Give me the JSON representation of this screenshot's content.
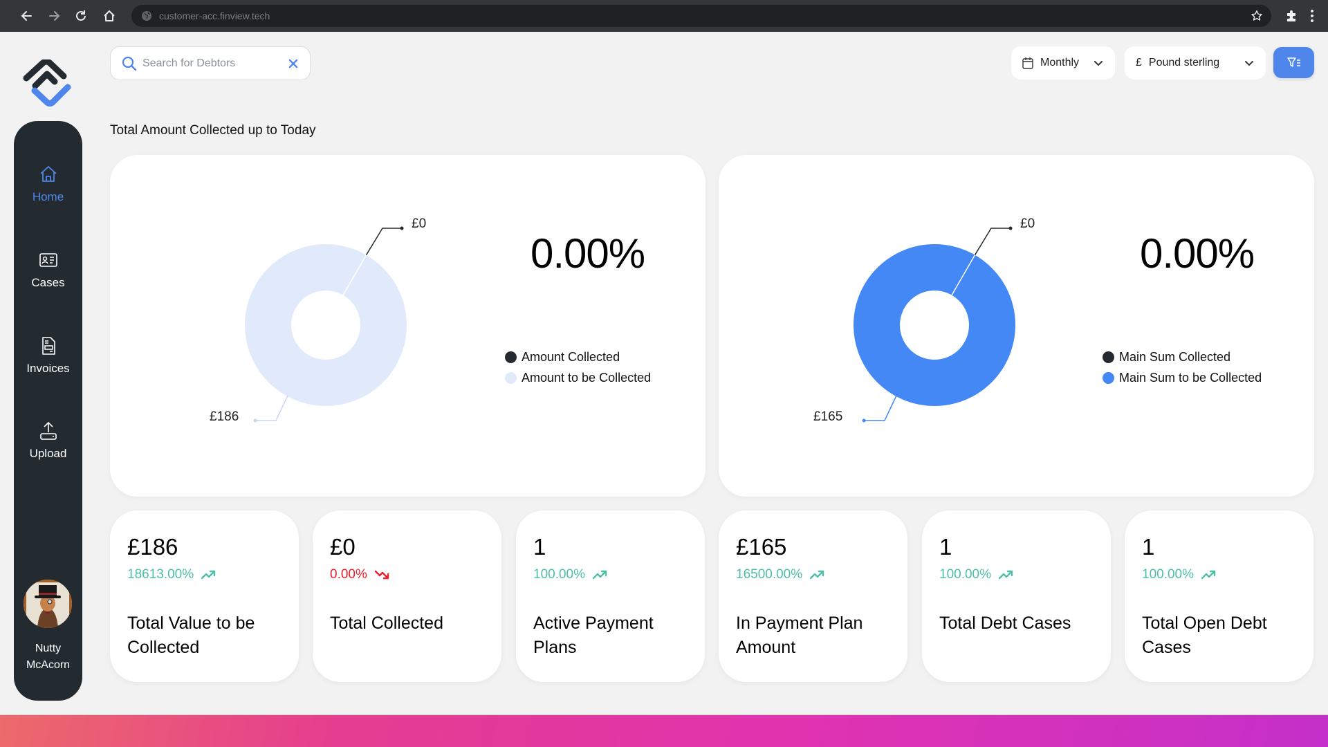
{
  "browser": {
    "url": "customer-acc.finview.tech",
    "icons": [
      "back-arrow-icon",
      "forward-arrow-icon",
      "reload-icon",
      "home-icon",
      "globe-icon",
      "bookmark-star-icon",
      "extensions-puzzle-icon",
      "kebab-menu-icon"
    ]
  },
  "search": {
    "placeholder": "Search for Debtors",
    "value": ""
  },
  "toolbar": {
    "period_label": "Monthly",
    "currency_symbol": "£",
    "currency_label": "Pound sterling"
  },
  "sidebar": {
    "items": [
      {
        "label": "Home",
        "icon": "home-icon",
        "active": true
      },
      {
        "label": "Cases",
        "icon": "id-card-icon",
        "active": false
      },
      {
        "label": "Invoices",
        "icon": "invoice-document-icon",
        "active": false
      },
      {
        "label": "Upload",
        "icon": "upload-icon",
        "active": false
      }
    ],
    "user": {
      "first_name": "Nutty",
      "last_name": "McAcorn"
    }
  },
  "section_title": "Total Amount Collected up to Today",
  "colors": {
    "accent": "#4f86ec",
    "dark": "#232b30",
    "positive": "#4ebfa7",
    "negative": "#f01d2a",
    "light_blue": "#e1eafb",
    "chart_blue": "#4488f6"
  },
  "chart_data": [
    {
      "type": "pie",
      "variant": "donut",
      "title": "Amount Collected",
      "percentage_label": "0.00%",
      "categories": [
        "Amount Collected",
        "Amount to be Collected"
      ],
      "values": [
        0,
        186
      ],
      "value_labels": [
        "£0",
        "£186"
      ],
      "colors": [
        "#232b30",
        "#e1eafb"
      ],
      "legend": "right"
    },
    {
      "type": "pie",
      "variant": "donut",
      "title": "Main Sum Collected",
      "percentage_label": "0.00%",
      "categories": [
        "Main Sum Collected",
        "Main Sum to be Collected"
      ],
      "values": [
        0,
        165
      ],
      "value_labels": [
        "£0",
        "£165"
      ],
      "colors": [
        "#232b30",
        "#4488f6"
      ],
      "legend": "right"
    }
  ],
  "stats": [
    {
      "value": "£186",
      "change": "18613.00%",
      "trend": "up",
      "label": "Total Value to be Collected"
    },
    {
      "value": "£0",
      "change": "0.00%",
      "trend": "down",
      "label": "Total Collected"
    },
    {
      "value": "1",
      "change": "100.00%",
      "trend": "up",
      "label": "Active Payment Plans"
    },
    {
      "value": "£165",
      "change": "16500.00%",
      "trend": "up",
      "label": "In Payment Plan Amount"
    },
    {
      "value": "1",
      "change": "100.00%",
      "trend": "up",
      "label": "Total Debt Cases"
    },
    {
      "value": "1",
      "change": "100.00%",
      "trend": "up",
      "label": "Total Open Debt Cases"
    }
  ]
}
